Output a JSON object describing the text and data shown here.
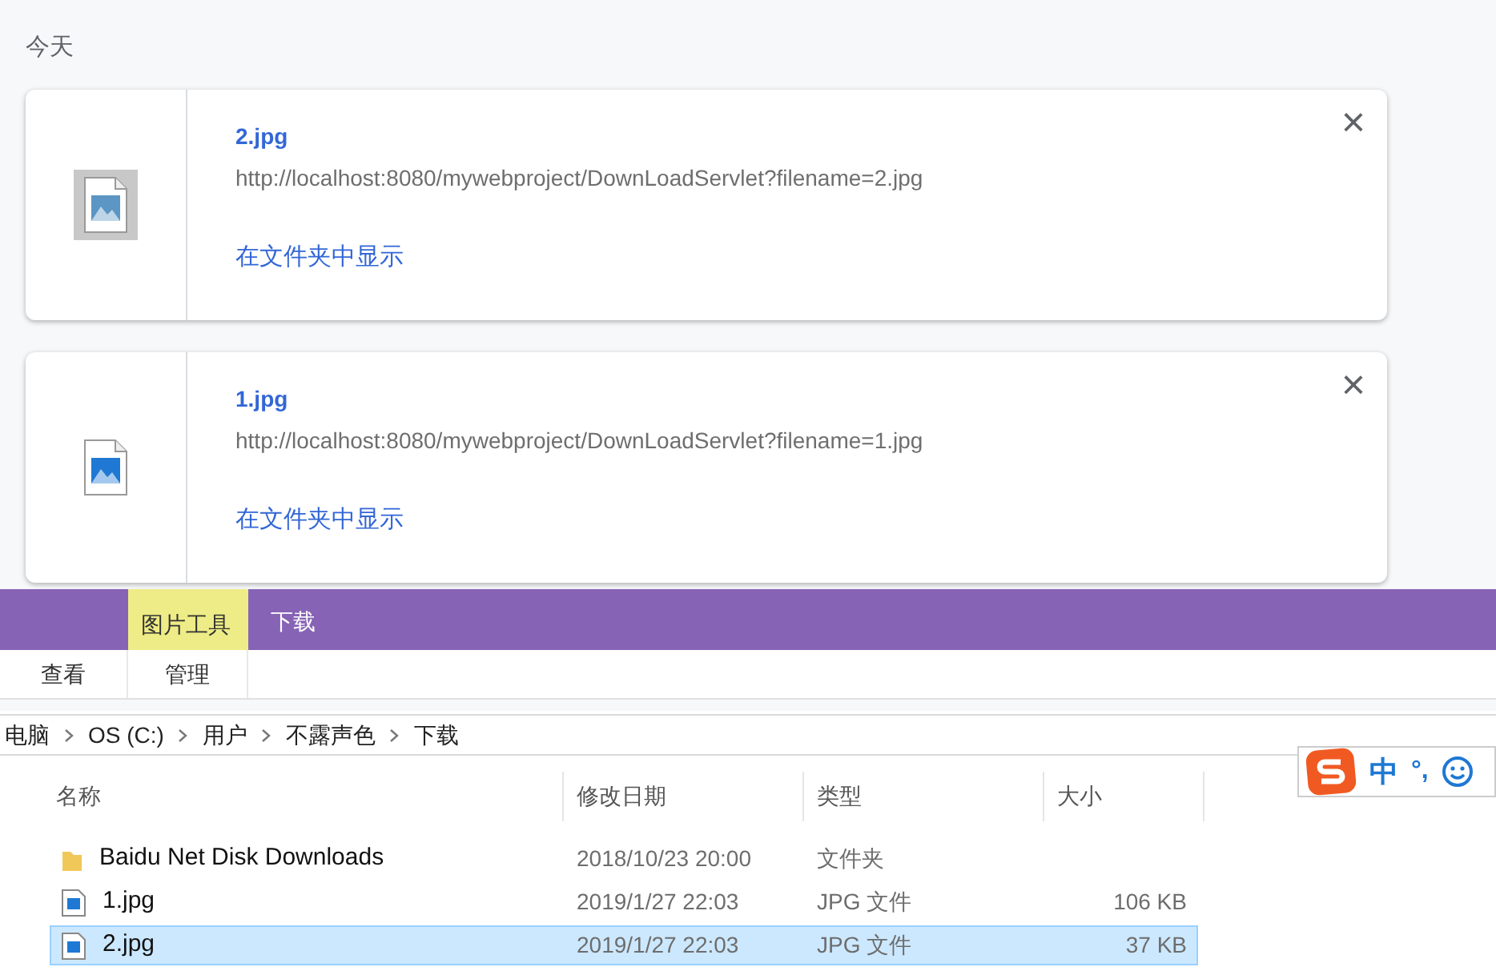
{
  "section_title": "今天",
  "downloads": [
    {
      "filename": "2.jpg",
      "url": "http://localhost:8080/mywebproject/DownLoadServlet?filename=2.jpg",
      "action": "在文件夹中显示",
      "close": "×",
      "selected": true
    },
    {
      "filename": "1.jpg",
      "url": "http://localhost:8080/mywebproject/DownLoadServlet?filename=1.jpg",
      "action": "在文件夹中显示",
      "close": "×",
      "selected": false
    }
  ],
  "explorer": {
    "context_tab": "图片工具",
    "window_title": "下载",
    "ribbon_tabs": [
      {
        "label": "查看",
        "selected": false
      },
      {
        "label": "管理",
        "selected": false
      }
    ],
    "breadcrumb": [
      "电脑",
      "OS (C:)",
      "用户",
      "不露声色",
      "下载"
    ],
    "columns": [
      "名称",
      "修改日期",
      "类型",
      "大小"
    ],
    "rows": [
      {
        "kind": "folder",
        "name": "Baidu Net Disk Downloads",
        "date": "2018/10/23 20:00",
        "type": "文件夹",
        "size": "",
        "selected": false
      },
      {
        "kind": "image",
        "name": "1.jpg",
        "date": "2019/1/27 22:03",
        "type": "JPG 文件",
        "size": "106 KB",
        "selected": false
      },
      {
        "kind": "image",
        "name": "2.jpg",
        "date": "2019/1/27 22:03",
        "type": "JPG 文件",
        "size": "37 KB",
        "selected": true
      }
    ]
  },
  "ime": {
    "mode": "中",
    "punct": "°,"
  }
}
